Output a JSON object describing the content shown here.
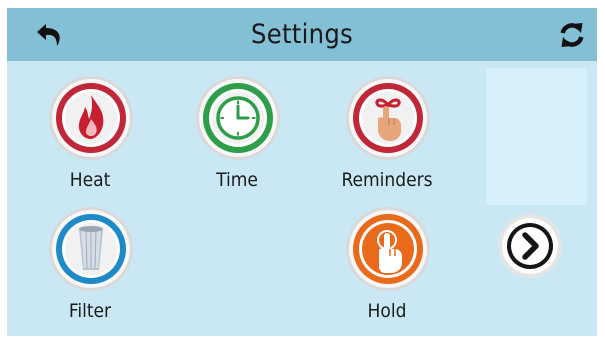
{
  "header": {
    "title": "Settings",
    "back_icon": "back-arrow-icon",
    "refresh_icon": "refresh-icon"
  },
  "menu": [
    {
      "label": "Heat",
      "icon": "flame-icon",
      "ring_color": "#c0283a"
    },
    {
      "label": "Time",
      "icon": "clock-icon",
      "ring_color": "#2e9e4a"
    },
    {
      "label": "Reminders",
      "icon": "reminder-hand-icon",
      "ring_color": "#c0283a"
    },
    {
      "label": "Filter",
      "icon": "filter-cartridge-icon",
      "ring_color": "#1e8ac8"
    },
    {
      "label": "Hold",
      "icon": "hold-hand-icon",
      "ring_color": "#e86a1a"
    }
  ],
  "nav": {
    "next_icon": "chevron-right-icon"
  },
  "colors": {
    "header_bg": "#83bfd5",
    "screen_bg": "#c9e8f4",
    "panel_bg": "#d6eff9"
  }
}
